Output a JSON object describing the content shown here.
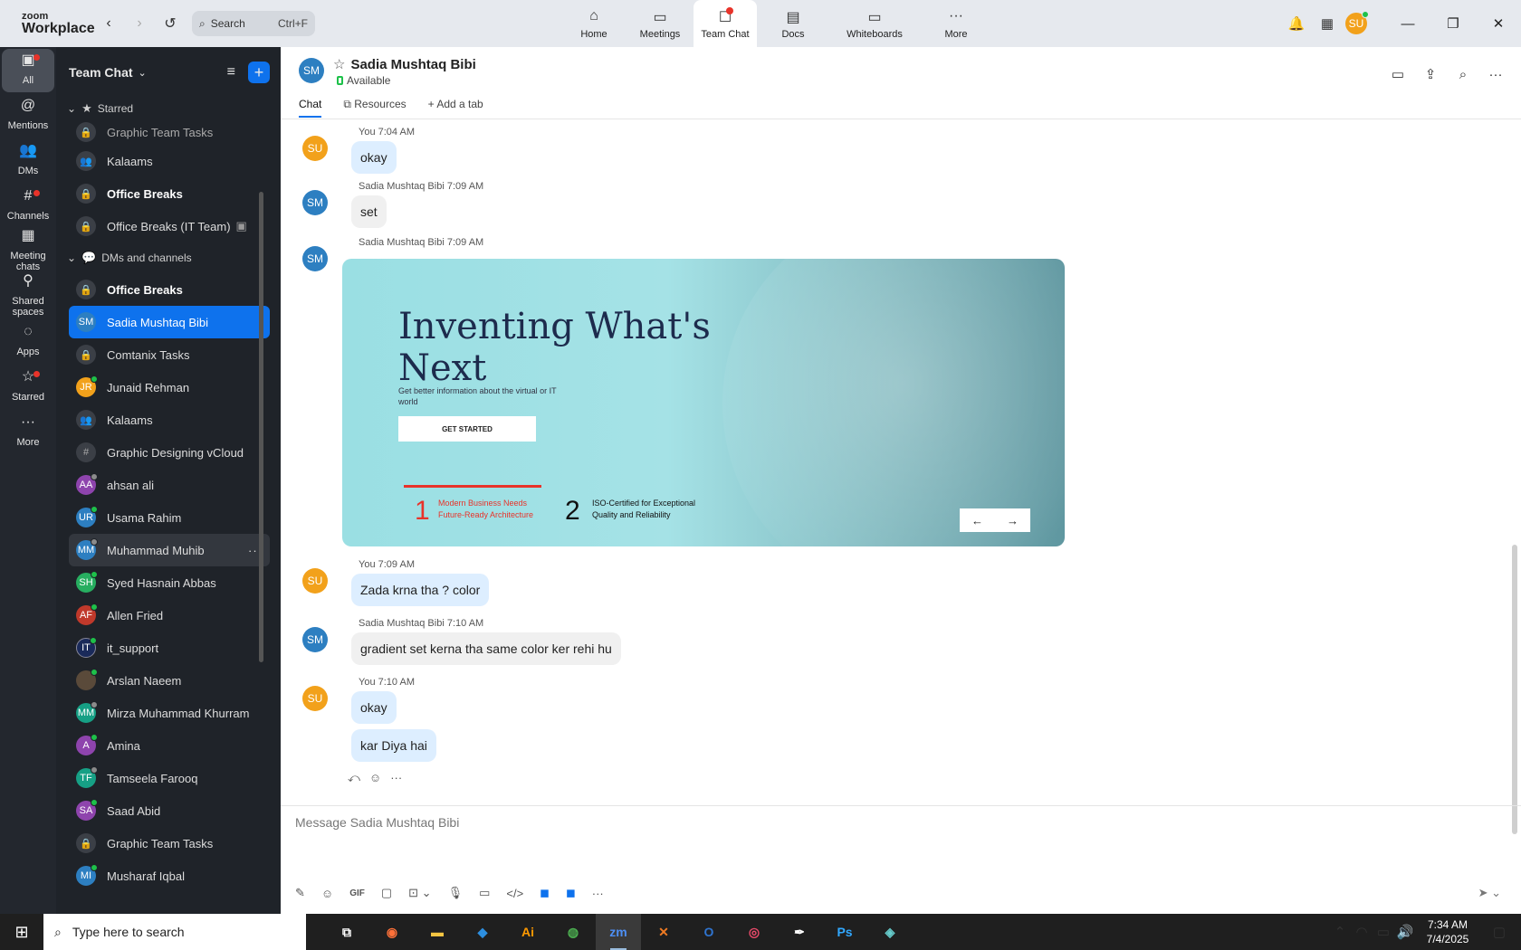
{
  "app": {
    "brand_top": "zoom",
    "brand_bottom": "Workplace"
  },
  "search": {
    "label": "Search",
    "shortcut": "Ctrl+F"
  },
  "topnav": [
    {
      "label": "Home",
      "icon": "home-icon",
      "glyph": "⌂"
    },
    {
      "label": "Meetings",
      "icon": "video-icon",
      "glyph": "▭"
    },
    {
      "label": "Team Chat",
      "icon": "chat-icon",
      "glyph": "☐"
    },
    {
      "label": "Docs",
      "icon": "doc-icon",
      "glyph": "▤"
    },
    {
      "label": "Whiteboards",
      "icon": "whiteboard-icon",
      "glyph": "▭"
    },
    {
      "label": "More",
      "icon": "more-icon",
      "glyph": "···"
    }
  ],
  "user_initials": "SU",
  "rail": [
    {
      "label": "All",
      "glyph": "▣"
    },
    {
      "label": "Mentions",
      "glyph": "@"
    },
    {
      "label": "DMs",
      "glyph": "👥"
    },
    {
      "label": "Channels",
      "glyph": "#"
    },
    {
      "label": "Meeting chats",
      "glyph": "▦"
    },
    {
      "label": "Shared spaces",
      "glyph": "⚲"
    },
    {
      "label": "Apps",
      "glyph": "◌"
    },
    {
      "label": "Starred",
      "glyph": "☆"
    },
    {
      "label": "More",
      "glyph": "···"
    }
  ],
  "sidebar": {
    "title": "Team Chat",
    "starred_label": "Starred",
    "starred": [
      "Graphic Team Tasks",
      "Kalaams",
      "Office Breaks",
      "Office Breaks (IT Team)"
    ],
    "dms_label": "DMs and channels",
    "dms": [
      {
        "name": "Office Breaks",
        "initials": ""
      },
      {
        "name": "Sadia Mushtaq Bibi",
        "initials": "SM"
      },
      {
        "name": "Comtanix Tasks",
        "initials": ""
      },
      {
        "name": "Junaid Rehman",
        "initials": "JR"
      },
      {
        "name": "Kalaams",
        "initials": ""
      },
      {
        "name": "Graphic Designing vCloud",
        "initials": ""
      },
      {
        "name": "ahsan ali",
        "initials": "AA"
      },
      {
        "name": "Usama Rahim",
        "initials": "UR"
      },
      {
        "name": "Muhammad Muhib",
        "initials": "MM"
      },
      {
        "name": "Syed Hasnain Abbas",
        "initials": "SH"
      },
      {
        "name": "Allen Fried",
        "initials": "AF"
      },
      {
        "name": "it_support",
        "initials": "IT"
      },
      {
        "name": "Arslan Naeem",
        "initials": ""
      },
      {
        "name": "Mirza Muhammad Khurram",
        "initials": "MM"
      },
      {
        "name": "Amina",
        "initials": "A"
      },
      {
        "name": "Tamseela Farooq",
        "initials": "TF"
      },
      {
        "name": "Saad Abid",
        "initials": "SA"
      },
      {
        "name": "Graphic Team Tasks",
        "initials": ""
      },
      {
        "name": "Musharaf Iqbal",
        "initials": "MI"
      }
    ]
  },
  "chat": {
    "name": "Sadia Mushtaq Bibi",
    "initials": "SM",
    "status": "Available",
    "tabs": [
      "Chat",
      "Resources",
      "Add a tab"
    ],
    "messages": [
      {
        "meta": "You 7:04 AM",
        "text": "okay"
      },
      {
        "meta": "Sadia Mushtaq Bibi 7:09 AM",
        "text": "set"
      },
      {
        "meta": "Sadia Mushtaq Bibi 7:09 AM",
        "text": ""
      },
      {
        "meta": "You 7:09 AM",
        "text": "Zada krna tha ? color"
      },
      {
        "meta": "Sadia Mushtaq Bibi 7:10 AM",
        "text": "gradient set kerna tha same color ker rehi hu"
      },
      {
        "meta": "You 7:10 AM",
        "text": "okay"
      },
      {
        "meta": "",
        "text": "kar Diya hai"
      }
    ],
    "banner": {
      "title": "Inventing What's Next",
      "sub": "Get better information about the virtual or IT world",
      "button": "GET STARTED",
      "n1": "1",
      "t1": "Modern Business Needs Future-Ready Architecture",
      "n2": "2",
      "t2": "ISO-Certified for Exceptional Quality and Reliability"
    },
    "placeholder": "Message Sadia Mushtaq Bibi"
  },
  "taskbar": {
    "search": "Type here to search",
    "time": "7:34 AM",
    "date": "7/4/2025"
  },
  "colors": {
    "accent": "#0e72ed",
    "sidebar": "#1f2329",
    "rail": "#23272e"
  }
}
